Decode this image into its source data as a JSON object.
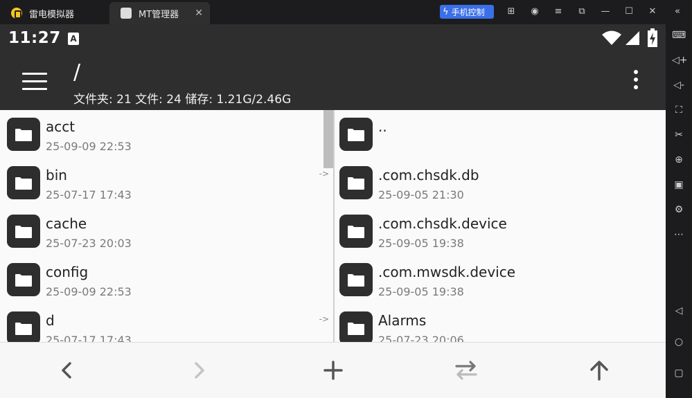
{
  "window": {
    "tabs": [
      {
        "label": "雷电模拟器"
      },
      {
        "label": "MT管理器"
      }
    ],
    "phone_control_label": "手机控制"
  },
  "status": {
    "time": "11:27",
    "ime_indicator": "A"
  },
  "appbar": {
    "path": "/",
    "stats": "文件夹: 21  文件: 24  储存: 1.21G/2.46G"
  },
  "left_panel": {
    "items": [
      {
        "name": "acct",
        "date": "25-09-09 22:53",
        "link": ""
      },
      {
        "name": "bin",
        "date": "25-07-17 17:43",
        "link": "->"
      },
      {
        "name": "cache",
        "date": "25-07-23 20:03",
        "link": ""
      },
      {
        "name": "config",
        "date": "25-09-09 22:53",
        "link": ""
      },
      {
        "name": "d",
        "date": "25-07-17 17:43",
        "link": "->"
      }
    ]
  },
  "right_panel": {
    "items": [
      {
        "name": "..",
        "date": ""
      },
      {
        "name": ".com.chsdk.db",
        "date": "25-09-05 21:30"
      },
      {
        "name": ".com.chsdk.device",
        "date": "25-09-05 19:38"
      },
      {
        "name": ".com.mwsdk.device",
        "date": "25-09-05 19:38"
      },
      {
        "name": "Alarms",
        "date": "25-07-23 20:06"
      }
    ]
  },
  "toolbar": {
    "icons": [
      "back-arrow-icon",
      "forward-arrow-icon",
      "add-icon",
      "swap-icon",
      "up-arrow-icon"
    ]
  },
  "colors": {
    "appbar": "#2e2e2e",
    "accent": "#3a6fe8",
    "background": "#fafafa"
  }
}
